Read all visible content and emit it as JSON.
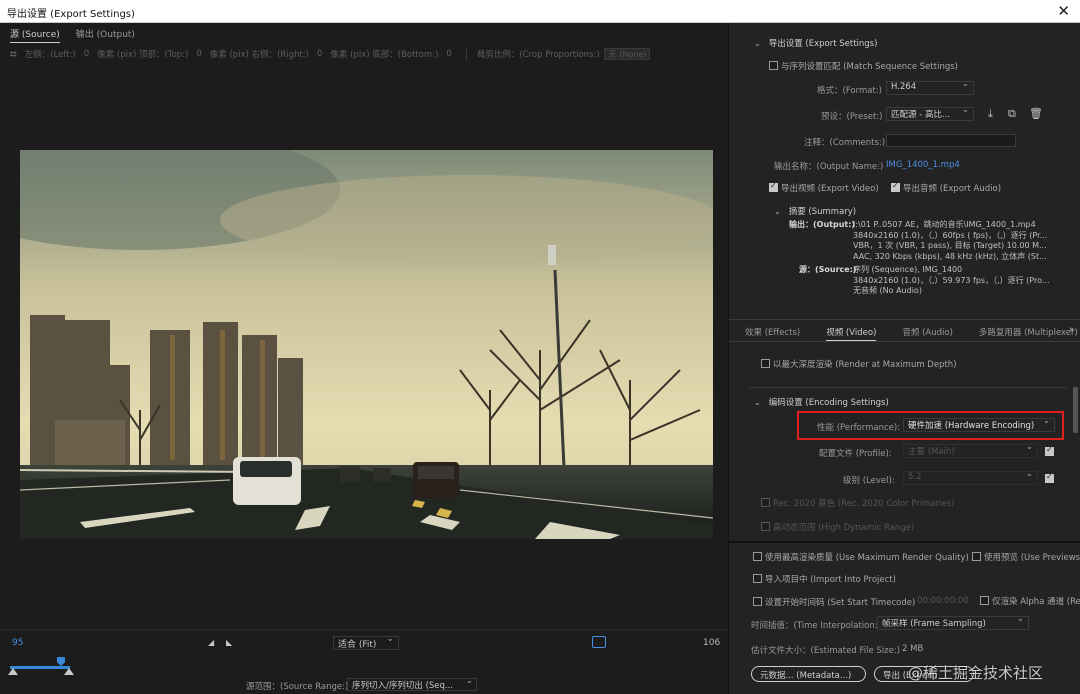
{
  "window": {
    "title": "导出设置 (Export Settings)",
    "close": "✕"
  },
  "left": {
    "tabs": [
      "源 (Source)",
      "输出 (Output)"
    ],
    "crop": {
      "left_label": "左侧：(Left:)",
      "left_val": "0",
      "top_label": "像素 (pix) 顶部：(Top:)",
      "top_val": "0",
      "right_label": "像素 (pix) 右侧：(Right:)",
      "right_val": "0",
      "bottom_label": "像素 (pix) 底部：(Bottom:)",
      "bottom_val": "0",
      "ratio_label": "裁剪比例：(Crop Proportions:)",
      "ratio_value": "无 (None)"
    },
    "timeline": {
      "in_frame": "95",
      "out_frame": "106",
      "fit": "适合 (Fit)"
    },
    "source_range_label": "源范围：(Source Range:)",
    "source_range_value": "序列切入/序列切出 (Seq..."
  },
  "export": {
    "section": "导出设置 (Export Settings)",
    "match_sequence": "与序列设置匹配 (Match Sequence Settings)",
    "format_label": "格式：(Format:)",
    "format_value": "H.264",
    "preset_label": "预设：(Preset:)",
    "preset_value": "匹配源 - 高比...",
    "comments_label": "注释：(Comments:)",
    "output_name_label": "输出名称：(Output Name:)",
    "output_name_value": "IMG_1400_1.mp4",
    "export_video": "导出视频 (Export Video)",
    "export_audio": "导出音频 (Export Audio)",
    "summary_title": "摘要 (Summary)",
    "output_key": "输出：(Output:)",
    "output_lines": [
      "I:\\01 P..0507 AE，跳动的音乐\\IMG_1400_1.mp4",
      "3840x2160 (1.0)，（,）60fps ( fps)，（,）逐行 (Pr...",
      "VBR，1 次 (VBR, 1 pass), 目标 (Target) 10.00 M...",
      "AAC, 320 Kbps (kbps), 48 kHz (kHz), 立体声 (St..."
    ],
    "source_key": "源：(Source:)",
    "source_lines": [
      "序列 (Sequence), IMG_1400",
      "3840x2160 (1.0)，（,）59.973 fps，（,）逐行 (Pro...",
      "无音频 (No Audio)"
    ]
  },
  "tabs": [
    "效果 (Effects)",
    "视频 (Video)",
    "音频 (Audio)",
    "多路复用器 (Multiplexer)"
  ],
  "video": {
    "max_depth": "以最大深度渲染 (Render at Maximum Depth)",
    "encoding_section": "编码设置 (Encoding Settings)",
    "performance_label": "性能 (Performance):",
    "performance_value": "硬件加速 (Hardware Encoding)",
    "profile_label": "配置文件 (Profile):",
    "profile_value": "主要 (Main)",
    "level_label": "级别 (Level):",
    "level_value": "5.2",
    "rec2020": "Rec. 2020 基色 (Rec. 2020 Color Primaries)",
    "hdr": "高动态范围 (High Dynamic Range)"
  },
  "bottom": {
    "max_quality": "使用最高渲染质量 (Use Maximum Render Quality)",
    "use_previews": "使用预览 (Use Previews)",
    "import_project": "导入项目中 (Import Into Project)",
    "set_timecode": "设置开始时间码 (Set Start Timecode)",
    "timecode": "00:00:00:00",
    "alpha_only": "仅渲染 Alpha 通道 (Rend...",
    "interp_label": "时间插值：(Time Interpolation:)",
    "interp_value": "帧采样 (Frame Sampling)",
    "filesize_label": "估计文件大小：(Estimated File Size:)",
    "filesize_value": "2 MB",
    "metadata_btn": "元数据... (Metadata...)",
    "export_btn": "导出 (Export)",
    "watermark": "@稀土掘金技术社区"
  }
}
